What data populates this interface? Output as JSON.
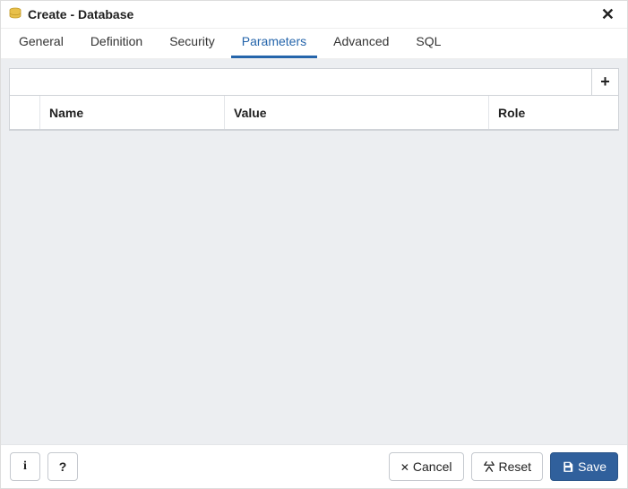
{
  "header": {
    "title": "Create - Database"
  },
  "tabs": [
    {
      "label": "General",
      "active": false
    },
    {
      "label": "Definition",
      "active": false
    },
    {
      "label": "Security",
      "active": false
    },
    {
      "label": "Parameters",
      "active": true
    },
    {
      "label": "Advanced",
      "active": false
    },
    {
      "label": "SQL",
      "active": false
    }
  ],
  "grid": {
    "columns": {
      "name": "Name",
      "value": "Value",
      "role": "Role"
    },
    "rows": []
  },
  "footer": {
    "info": "i",
    "help": "?",
    "cancel": "Cancel",
    "reset": "Reset",
    "save": "Save"
  }
}
